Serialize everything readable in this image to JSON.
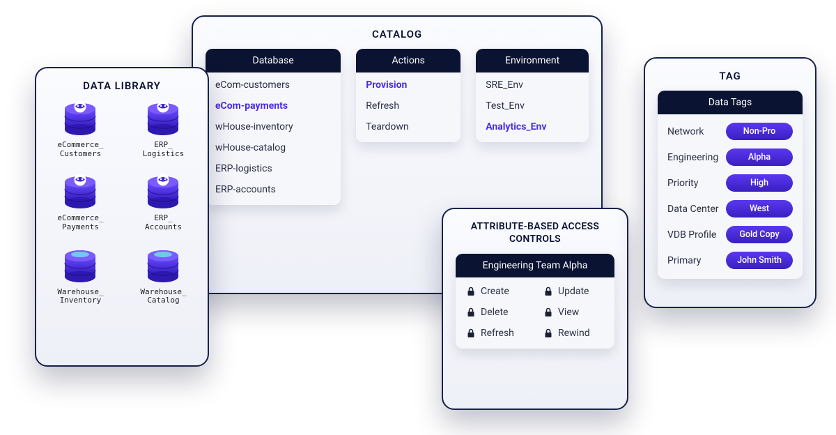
{
  "data_library": {
    "title": "DATA LIBRARY",
    "items": [
      {
        "line1": "eCommerce_",
        "line2": "Customers",
        "icon": "masked"
      },
      {
        "line1": "ERP_",
        "line2": "Logistics",
        "icon": "masked"
      },
      {
        "line1": "eCommerce_",
        "line2": "Payments",
        "icon": "masked"
      },
      {
        "line1": "ERP_",
        "line2": "Accounts",
        "icon": "masked"
      },
      {
        "line1": "Warehouse_",
        "line2": "Inventory",
        "icon": "plain"
      },
      {
        "line1": "Warehouse_",
        "line2": "Catalog",
        "icon": "plain"
      }
    ]
  },
  "catalog": {
    "title": "CATALOG",
    "columns": {
      "database": {
        "header": "Database",
        "items": [
          {
            "label": "eCom-customers",
            "selected": false
          },
          {
            "label": "eCom-payments",
            "selected": true
          },
          {
            "label": "wHouse-inventory",
            "selected": false
          },
          {
            "label": "wHouse-catalog",
            "selected": false
          },
          {
            "label": "ERP-logistics",
            "selected": false
          },
          {
            "label": "ERP-accounts",
            "selected": false
          }
        ]
      },
      "actions": {
        "header": "Actions",
        "items": [
          {
            "label": "Provision",
            "selected": true
          },
          {
            "label": "Refresh",
            "selected": false
          },
          {
            "label": "Teardown",
            "selected": false
          }
        ]
      },
      "environment": {
        "header": "Environment",
        "items": [
          {
            "label": "SRE_Env",
            "selected": false
          },
          {
            "label": "Test_Env",
            "selected": false
          },
          {
            "label": "Analytics_Env",
            "selected": true
          }
        ]
      }
    }
  },
  "abac": {
    "title": "ATTRIBUTE-BASED ACCESS CONTROLS",
    "group_header": "Engineering Team Alpha",
    "perms": [
      "Create",
      "Update",
      "Delete",
      "View",
      "Refresh",
      "Rewind"
    ]
  },
  "tag": {
    "title": "TAG",
    "header": "Data Tags",
    "rows": [
      {
        "label": "Network",
        "pill": "Non-Pro"
      },
      {
        "label": "Engineering",
        "pill": "Alpha"
      },
      {
        "label": "Priority",
        "pill": "High"
      },
      {
        "label": "Data Center",
        "pill": "West"
      },
      {
        "label": "VDB Profile",
        "pill": "Gold Copy"
      },
      {
        "label": "Primary",
        "pill": "John Smith"
      }
    ]
  }
}
